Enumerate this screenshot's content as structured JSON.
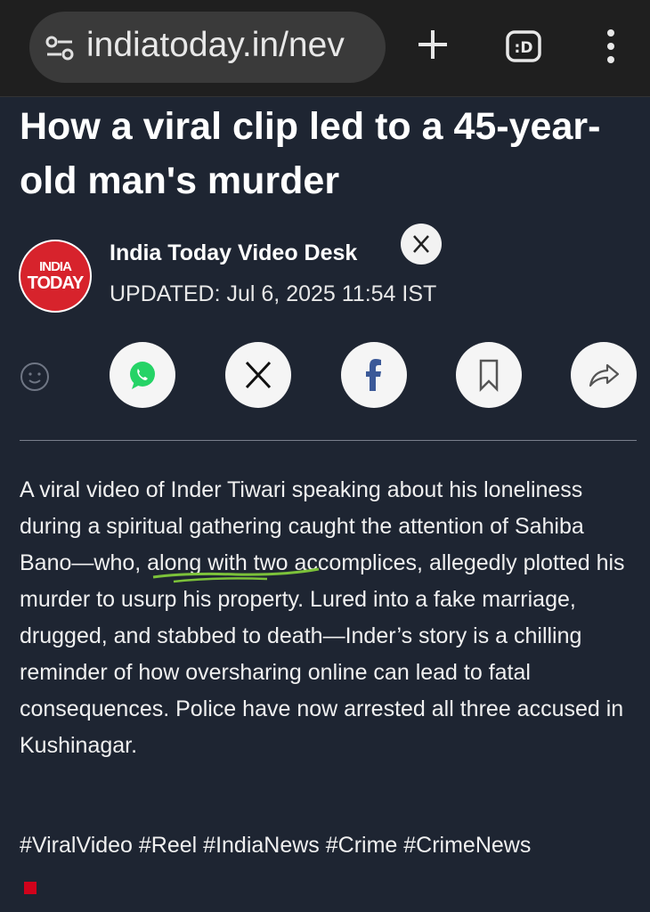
{
  "browser": {
    "url": "indiatoday.in/nev",
    "new_tab_icon": "plus-icon",
    "tabs_icon": "tab-switcher-icon",
    "tabs_label": ":D",
    "menu_icon": "kebab-menu-icon"
  },
  "article": {
    "headline": "How a viral clip led to a 45-year-old man's murder",
    "logo": {
      "line1": "INDIA",
      "line2": "TODAY"
    },
    "author": "India Today Video Desk",
    "author_social": "X",
    "updated": "UPDATED: Jul 6, 2025 11:54 IST",
    "share": [
      "whatsapp-icon",
      "x-icon",
      "facebook-icon",
      "bookmark-icon",
      "share-icon"
    ],
    "body_before": "A viral video of Inder Tiwari speaking about his loneliness during a spiritual gathering caught the attention of ",
    "body_highlight": "Sahiba Bano",
    "body_after": "—who, along with two accomplices, allegedly plotted his murder to usurp his property. Lured into a fake marriage, drugged, and stabbed to death—Inder’s story is a chilling reminder of how oversharing online can lead to fatal consequences. Police have now arrested all three accused in Kushinagar.",
    "hashtags": "#ViralVideo #Reel #IndiaNews #Crime #CrimeNews"
  },
  "colors": {
    "background": "#1e2532",
    "logo_red": "#d7232c",
    "underline_green": "#7cc23a",
    "facebook_blue": "#3b5998",
    "whatsapp_green": "#25d366"
  }
}
